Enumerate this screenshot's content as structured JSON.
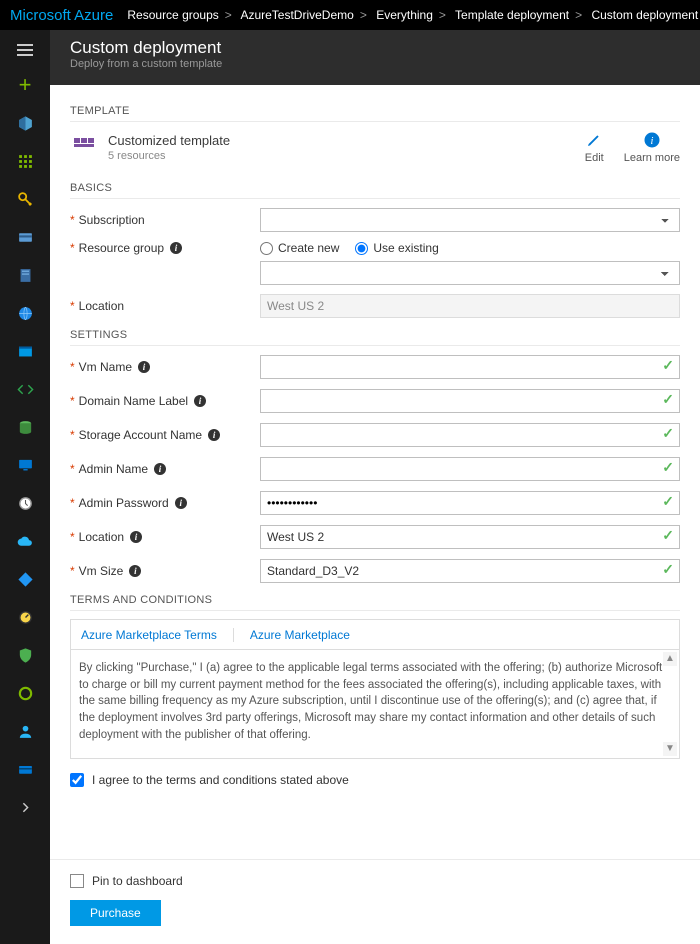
{
  "brand": "Microsoft Azure",
  "breadcrumbs": [
    "Resource groups",
    "AzureTestDriveDemo",
    "Everything",
    "Template deployment",
    "Custom deployment"
  ],
  "blade": {
    "title": "Custom deployment",
    "subtitle": "Deploy from a custom template"
  },
  "sections": {
    "template": "TEMPLATE",
    "basics": "BASICS",
    "settings": "SETTINGS",
    "terms": "TERMS AND CONDITIONS"
  },
  "template": {
    "name": "Customized template",
    "subtitle": "5 resources",
    "actions": {
      "edit": "Edit",
      "learn": "Learn more"
    }
  },
  "basics": {
    "subscription": {
      "label": "Subscription",
      "value": ""
    },
    "resource_group": {
      "label": "Resource group",
      "create": "Create new",
      "existing": "Use existing",
      "selected": "existing",
      "value": ""
    },
    "location": {
      "label": "Location",
      "value": "West US 2"
    }
  },
  "settings": {
    "vm_name": {
      "label": "Vm Name",
      "value": ""
    },
    "domain_name_label": {
      "label": "Domain Name Label",
      "value": ""
    },
    "storage_account_name": {
      "label": "Storage Account Name",
      "value": ""
    },
    "admin_name": {
      "label": "Admin Name",
      "value": ""
    },
    "admin_password": {
      "label": "Admin Password",
      "value": "••••••••••••"
    },
    "location": {
      "label": "Location",
      "value": "West US 2"
    },
    "vm_size": {
      "label": "Vm Size",
      "value": "Standard_D3_V2"
    }
  },
  "terms": {
    "tabs": [
      "Azure Marketplace Terms",
      "Azure Marketplace"
    ],
    "body": "By clicking \"Purchase,\" I (a) agree to the applicable legal terms associated with the offering; (b) authorize Microsoft to charge or bill my current payment method for the fees associated the offering(s), including applicable taxes, with the same billing frequency as my Azure subscription, until I discontinue use of the offering(s); and (c) agree that, if the deployment involves 3rd party offerings, Microsoft may share my contact information and other details of such deployment with the publisher of that offering.",
    "agree": "I agree to the terms and conditions stated above"
  },
  "footer": {
    "pin": "Pin to dashboard",
    "purchase": "Purchase"
  }
}
